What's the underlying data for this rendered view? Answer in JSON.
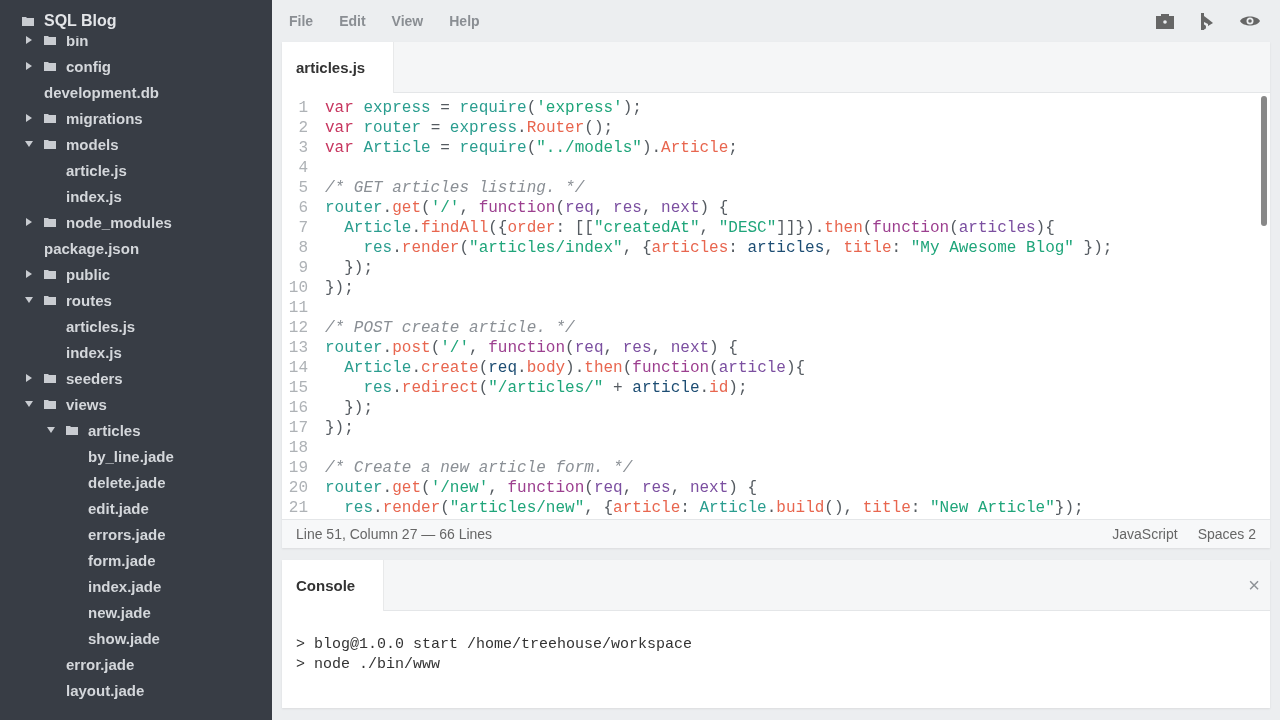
{
  "sidebar": {
    "project": "SQL Blog",
    "tree": [
      {
        "name": "bin",
        "kind": "folder",
        "expanded": false
      },
      {
        "name": "config",
        "kind": "folder",
        "expanded": false
      },
      {
        "name": "development.db",
        "kind": "file"
      },
      {
        "name": "migrations",
        "kind": "folder",
        "expanded": false
      },
      {
        "name": "models",
        "kind": "folder",
        "expanded": true,
        "children": [
          {
            "name": "article.js",
            "kind": "file"
          },
          {
            "name": "index.js",
            "kind": "file"
          }
        ]
      },
      {
        "name": "node_modules",
        "kind": "folder",
        "expanded": false
      },
      {
        "name": "package.json",
        "kind": "file"
      },
      {
        "name": "public",
        "kind": "folder",
        "expanded": false
      },
      {
        "name": "routes",
        "kind": "folder",
        "expanded": true,
        "children": [
          {
            "name": "articles.js",
            "kind": "file"
          },
          {
            "name": "index.js",
            "kind": "file"
          }
        ]
      },
      {
        "name": "seeders",
        "kind": "folder",
        "expanded": false
      },
      {
        "name": "views",
        "kind": "folder",
        "expanded": true,
        "children": [
          {
            "name": "articles",
            "kind": "folder",
            "expanded": true,
            "children": [
              {
                "name": "by_line.jade",
                "kind": "file"
              },
              {
                "name": "delete.jade",
                "kind": "file"
              },
              {
                "name": "edit.jade",
                "kind": "file"
              },
              {
                "name": "errors.jade",
                "kind": "file"
              },
              {
                "name": "form.jade",
                "kind": "file"
              },
              {
                "name": "index.jade",
                "kind": "file"
              },
              {
                "name": "new.jade",
                "kind": "file"
              },
              {
                "name": "show.jade",
                "kind": "file"
              }
            ]
          },
          {
            "name": "error.jade",
            "kind": "file"
          },
          {
            "name": "layout.jade",
            "kind": "file"
          }
        ]
      }
    ]
  },
  "menu": [
    "File",
    "Edit",
    "View",
    "Help"
  ],
  "toolbar": [
    {
      "kind": "camera"
    },
    {
      "kind": "flag"
    },
    {
      "kind": "eye"
    }
  ],
  "editor": {
    "tabs": [
      {
        "label": "articles.js",
        "selected": true
      }
    ],
    "lines": [
      {
        "number": "1",
        "tokens": [
          {
            "kind": "kw",
            "text": "var"
          },
          {
            "kind": "id",
            "text": " express"
          },
          {
            "kind": "plain",
            "text": " = "
          },
          {
            "kind": "id",
            "text": "require"
          },
          {
            "kind": "plain",
            "text": "("
          },
          {
            "kind": "str",
            "text": "'express'"
          },
          {
            "kind": "plain",
            "text": ");"
          }
        ]
      },
      {
        "number": "2",
        "tokens": [
          {
            "kind": "kw",
            "text": "var"
          },
          {
            "kind": "id",
            "text": " router"
          },
          {
            "kind": "plain",
            "text": " = "
          },
          {
            "kind": "id",
            "text": "express"
          },
          {
            "kind": "plain",
            "text": "."
          },
          {
            "kind": "prop",
            "text": "Router"
          },
          {
            "kind": "plain",
            "text": "();"
          }
        ]
      },
      {
        "number": "3",
        "tokens": [
          {
            "kind": "kw",
            "text": "var"
          },
          {
            "kind": "id",
            "text": " Article"
          },
          {
            "kind": "plain",
            "text": " = "
          },
          {
            "kind": "id",
            "text": "require"
          },
          {
            "kind": "plain",
            "text": "("
          },
          {
            "kind": "str",
            "text": "\"../models\""
          },
          {
            "kind": "plain",
            "text": ")."
          },
          {
            "kind": "prop",
            "text": "Article"
          },
          {
            "kind": "plain",
            "text": ";"
          }
        ]
      },
      {
        "number": "4"
      },
      {
        "number": "5",
        "tokens": [
          {
            "kind": "com",
            "text": "/* GET articles listing. */"
          }
        ]
      },
      {
        "number": "6",
        "tokens": [
          {
            "kind": "id",
            "text": "router"
          },
          {
            "kind": "plain",
            "text": "."
          },
          {
            "kind": "prop",
            "text": "get"
          },
          {
            "kind": "plain",
            "text": "("
          },
          {
            "kind": "str",
            "text": "'/'"
          },
          {
            "kind": "plain",
            "text": ", "
          },
          {
            "kind": "fn",
            "text": "function"
          },
          {
            "kind": "plain",
            "text": "("
          },
          {
            "kind": "param",
            "text": "req"
          },
          {
            "kind": "plain",
            "text": ", "
          },
          {
            "kind": "param",
            "text": "res"
          },
          {
            "kind": "plain",
            "text": ", "
          },
          {
            "kind": "param",
            "text": "next"
          },
          {
            "kind": "plain",
            "text": ") {"
          }
        ]
      },
      {
        "number": "7",
        "tokens": [
          {
            "kind": "id",
            "text": "  Article"
          },
          {
            "kind": "plain",
            "text": "."
          },
          {
            "kind": "prop",
            "text": "findAll"
          },
          {
            "kind": "plain",
            "text": "({"
          },
          {
            "kind": "prop",
            "text": "order"
          },
          {
            "kind": "plain",
            "text": ": [["
          },
          {
            "kind": "str",
            "text": "\"createdAt\""
          },
          {
            "kind": "plain",
            "text": ", "
          },
          {
            "kind": "str",
            "text": "\"DESC\""
          },
          {
            "kind": "plain",
            "text": "]]})."
          },
          {
            "kind": "prop",
            "text": "then"
          },
          {
            "kind": "plain",
            "text": "("
          },
          {
            "kind": "fn",
            "text": "function"
          },
          {
            "kind": "plain",
            "text": "("
          },
          {
            "kind": "param",
            "text": "articles"
          },
          {
            "kind": "plain",
            "text": "){"
          }
        ]
      },
      {
        "number": "8",
        "tokens": [
          {
            "kind": "id",
            "text": "    res"
          },
          {
            "kind": "plain",
            "text": "."
          },
          {
            "kind": "prop",
            "text": "render"
          },
          {
            "kind": "plain",
            "text": "("
          },
          {
            "kind": "str",
            "text": "\"articles/index\""
          },
          {
            "kind": "plain",
            "text": ", {"
          },
          {
            "kind": "prop",
            "text": "articles"
          },
          {
            "kind": "plain",
            "text": ": "
          },
          {
            "kind": "var",
            "text": "articles"
          },
          {
            "kind": "plain",
            "text": ", "
          },
          {
            "kind": "prop",
            "text": "title"
          },
          {
            "kind": "plain",
            "text": ": "
          },
          {
            "kind": "str",
            "text": "\"My Awesome Blog\""
          },
          {
            "kind": "plain",
            "text": " });"
          }
        ]
      },
      {
        "number": "9",
        "tokens": [
          {
            "kind": "plain",
            "text": "  });"
          }
        ]
      },
      {
        "number": "10",
        "tokens": [
          {
            "kind": "plain",
            "text": "});"
          }
        ]
      },
      {
        "number": "11"
      },
      {
        "number": "12",
        "tokens": [
          {
            "kind": "com",
            "text": "/* POST create article. */"
          }
        ]
      },
      {
        "number": "13",
        "tokens": [
          {
            "kind": "id",
            "text": "router"
          },
          {
            "kind": "plain",
            "text": "."
          },
          {
            "kind": "prop",
            "text": "post"
          },
          {
            "kind": "plain",
            "text": "("
          },
          {
            "kind": "str",
            "text": "'/'"
          },
          {
            "kind": "plain",
            "text": ", "
          },
          {
            "kind": "fn",
            "text": "function"
          },
          {
            "kind": "plain",
            "text": "("
          },
          {
            "kind": "param",
            "text": "req"
          },
          {
            "kind": "plain",
            "text": ", "
          },
          {
            "kind": "param",
            "text": "res"
          },
          {
            "kind": "plain",
            "text": ", "
          },
          {
            "kind": "param",
            "text": "next"
          },
          {
            "kind": "plain",
            "text": ") {"
          }
        ]
      },
      {
        "number": "14",
        "tokens": [
          {
            "kind": "id",
            "text": "  Article"
          },
          {
            "kind": "plain",
            "text": "."
          },
          {
            "kind": "prop",
            "text": "create"
          },
          {
            "kind": "plain",
            "text": "("
          },
          {
            "kind": "var",
            "text": "req"
          },
          {
            "kind": "plain",
            "text": "."
          },
          {
            "kind": "prop",
            "text": "body"
          },
          {
            "kind": "plain",
            "text": ")."
          },
          {
            "kind": "prop",
            "text": "then"
          },
          {
            "kind": "plain",
            "text": "("
          },
          {
            "kind": "fn",
            "text": "function"
          },
          {
            "kind": "plain",
            "text": "("
          },
          {
            "kind": "param",
            "text": "article"
          },
          {
            "kind": "plain",
            "text": "){"
          }
        ]
      },
      {
        "number": "15",
        "tokens": [
          {
            "kind": "id",
            "text": "    res"
          },
          {
            "kind": "plain",
            "text": "."
          },
          {
            "kind": "prop",
            "text": "redirect"
          },
          {
            "kind": "plain",
            "text": "("
          },
          {
            "kind": "str",
            "text": "\"/articles/\""
          },
          {
            "kind": "plain",
            "text": " + "
          },
          {
            "kind": "var",
            "text": "article"
          },
          {
            "kind": "plain",
            "text": "."
          },
          {
            "kind": "prop",
            "text": "id"
          },
          {
            "kind": "plain",
            "text": ");"
          }
        ]
      },
      {
        "number": "16",
        "tokens": [
          {
            "kind": "plain",
            "text": "  });"
          }
        ]
      },
      {
        "number": "17",
        "tokens": [
          {
            "kind": "plain",
            "text": "});"
          }
        ]
      },
      {
        "number": "18"
      },
      {
        "number": "19",
        "tokens": [
          {
            "kind": "com",
            "text": "/* Create a new article form. */"
          }
        ]
      },
      {
        "number": "20",
        "tokens": [
          {
            "kind": "id",
            "text": "router"
          },
          {
            "kind": "plain",
            "text": "."
          },
          {
            "kind": "prop",
            "text": "get"
          },
          {
            "kind": "plain",
            "text": "("
          },
          {
            "kind": "str",
            "text": "'/new'"
          },
          {
            "kind": "plain",
            "text": ", "
          },
          {
            "kind": "fn",
            "text": "function"
          },
          {
            "kind": "plain",
            "text": "("
          },
          {
            "kind": "param",
            "text": "req"
          },
          {
            "kind": "plain",
            "text": ", "
          },
          {
            "kind": "param",
            "text": "res"
          },
          {
            "kind": "plain",
            "text": ", "
          },
          {
            "kind": "param",
            "text": "next"
          },
          {
            "kind": "plain",
            "text": ") {"
          }
        ]
      },
      {
        "number": "21",
        "tokens": [
          {
            "kind": "id",
            "text": "  res"
          },
          {
            "kind": "plain",
            "text": "."
          },
          {
            "kind": "prop",
            "text": "render"
          },
          {
            "kind": "plain",
            "text": "("
          },
          {
            "kind": "str",
            "text": "\"articles/new\""
          },
          {
            "kind": "plain",
            "text": ", {"
          },
          {
            "kind": "prop",
            "text": "article"
          },
          {
            "kind": "plain",
            "text": ": "
          },
          {
            "kind": "id",
            "text": "Article"
          },
          {
            "kind": "plain",
            "text": "."
          },
          {
            "kind": "prop",
            "text": "build"
          },
          {
            "kind": "plain",
            "text": "(), "
          },
          {
            "kind": "prop",
            "text": "title"
          },
          {
            "kind": "plain",
            "text": ": "
          },
          {
            "kind": "str",
            "text": "\"New Article\""
          },
          {
            "kind": "plain",
            "text": "});"
          }
        ]
      }
    ],
    "status_bar": {
      "position": "Line 51, Column 27 — 66 Lines",
      "language": "JavaScript",
      "indent": "Spaces 2"
    }
  },
  "console": {
    "tabs": [
      {
        "label": "Console",
        "selected": true
      }
    ],
    "close": "×",
    "lines": [
      "> blog@1.0.0 start /home/treehouse/workspace",
      "> node ./bin/www"
    ]
  }
}
